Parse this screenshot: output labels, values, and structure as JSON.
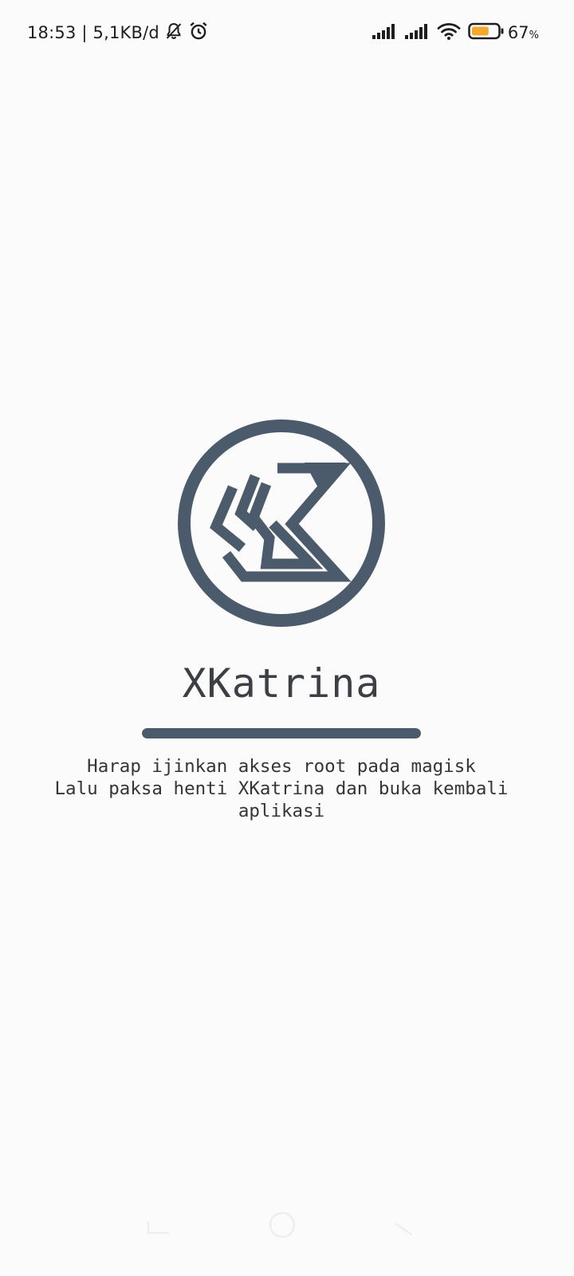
{
  "status_bar": {
    "time_and_speed": "18:53 | 5,1KB/d",
    "battery_level": "67",
    "battery_unit": "%",
    "battery_fraction": 0.67,
    "icons": [
      "bell-off-icon",
      "alarm-icon",
      "signal-icon",
      "signal-icon",
      "wifi-icon",
      "battery-icon"
    ]
  },
  "app": {
    "title": "XKatrina",
    "message_lines": [
      "Harap ijinkan akses root pada magisk",
      "Lalu paksa henti XKatrina dan buka kembali",
      "aplikasi"
    ],
    "progress_fraction": 1.0
  },
  "navigation": {
    "buttons": [
      "recents",
      "home",
      "back"
    ]
  },
  "colors": {
    "background": "#fbfbfc",
    "brand": "#4c5b6b",
    "battery": "#f2a92d"
  }
}
